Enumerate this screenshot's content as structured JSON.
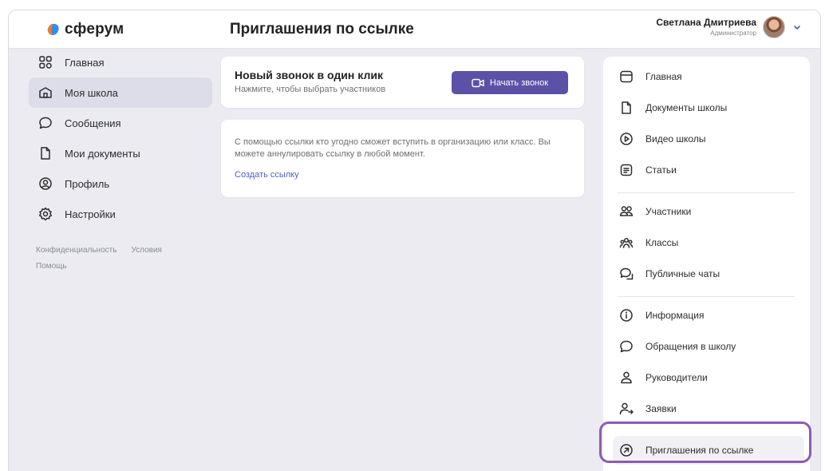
{
  "app": {
    "logo_text": "сферум",
    "page_title": "Приглашения по ссылке"
  },
  "user": {
    "name": "Светлана Дмитриева",
    "role": "Администратор"
  },
  "left_nav": {
    "items": [
      {
        "label": "Главная",
        "icon": "home-grid-icon"
      },
      {
        "label": "Моя школа",
        "icon": "school-icon",
        "active": true
      },
      {
        "label": "Сообщения",
        "icon": "message-icon"
      },
      {
        "label": "Мои документы",
        "icon": "document-icon"
      },
      {
        "label": "Профиль",
        "icon": "profile-icon"
      },
      {
        "label": "Настройки",
        "icon": "gear-icon"
      }
    ],
    "footer": {
      "privacy": "Конфиденциальность",
      "terms": "Условия",
      "help": "Помощь"
    }
  },
  "call_card": {
    "title": "Новый звонок в один клик",
    "subtitle": "Нажмите, чтобы выбрать участников",
    "button_label": "Начать звонок"
  },
  "link_card": {
    "description": "С помощью ссылки кто угодно сможет вступить в организацию или класс. Вы можете аннулировать ссылку в любой момент.",
    "action": "Создать ссылку"
  },
  "right_panel": {
    "group1": [
      "Главная",
      "Документы школы",
      "Видео школы",
      "Статьи"
    ],
    "group2": [
      "Участники",
      "Классы",
      "Публичные чаты"
    ],
    "group3": [
      "Информация",
      "Обращения в школу",
      "Руководители",
      "Заявки",
      "Приглашения по ссылке"
    ],
    "selected": "Приглашения по ссылке"
  },
  "colors": {
    "accent": "#5b51a7",
    "link": "#4e5fc1",
    "highlight_ring": "#8c5bb3",
    "background": "#ebebf1"
  }
}
